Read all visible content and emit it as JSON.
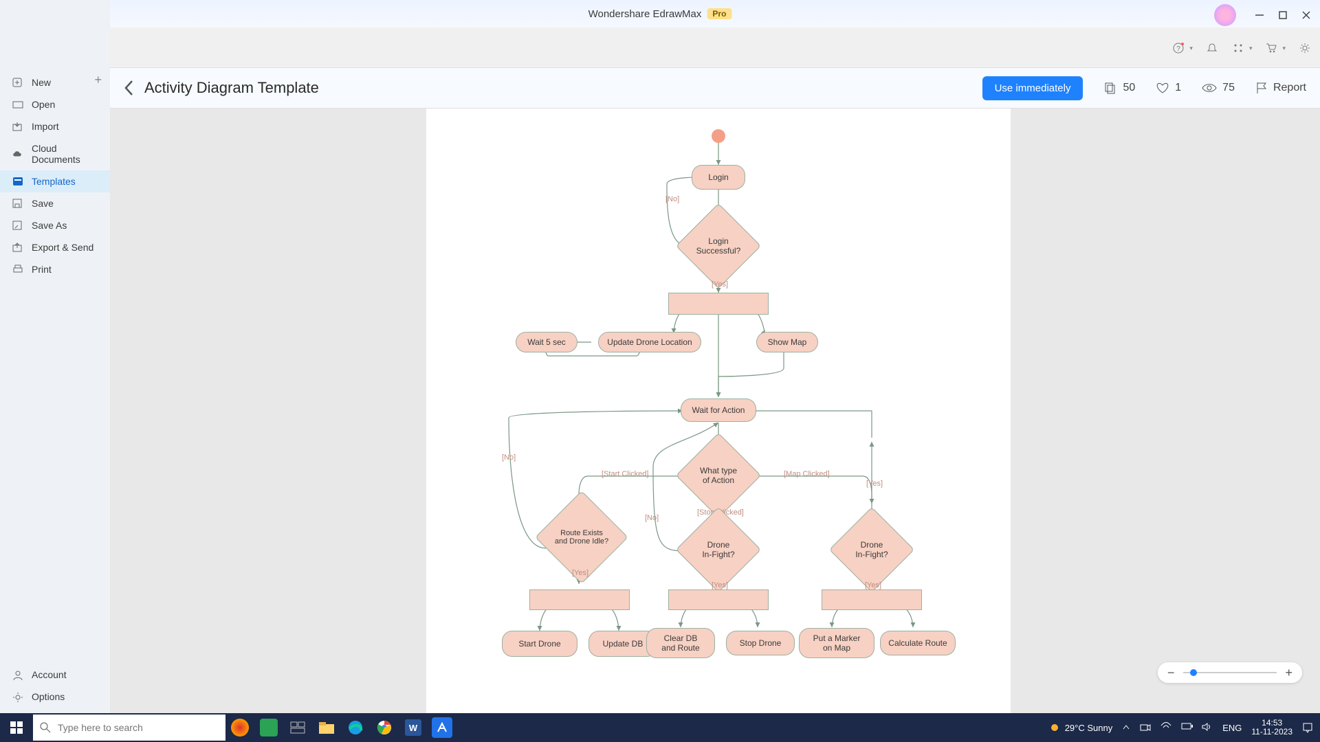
{
  "app": {
    "title": "Wondershare EdrawMax",
    "badge": "Pro"
  },
  "sidebar": {
    "items": [
      {
        "label": "New",
        "icon": "plus-box"
      },
      {
        "label": "Open",
        "icon": "folder-open"
      },
      {
        "label": "Import",
        "icon": "import"
      },
      {
        "label": "Cloud Documents",
        "icon": "cloud"
      },
      {
        "label": "Templates",
        "icon": "template"
      },
      {
        "label": "Save",
        "icon": "save"
      },
      {
        "label": "Save As",
        "icon": "save-as"
      },
      {
        "label": "Export & Send",
        "icon": "export"
      },
      {
        "label": "Print",
        "icon": "print"
      }
    ],
    "bottom": [
      {
        "label": "Account",
        "icon": "account"
      },
      {
        "label": "Options",
        "icon": "gear"
      }
    ]
  },
  "header": {
    "breadcrumb_title": "Activity Diagram Template",
    "use_button": "Use immediately",
    "copies": "50",
    "likes": "1",
    "views": "75",
    "report": "Report"
  },
  "flow": {
    "nodes": {
      "login": "Login",
      "login_successful": "Login\nSuccessful?",
      "wait5": "Wait 5 sec",
      "update_drone_loc": "Update Drone Location",
      "show_map": "Show Map",
      "wait_action": "Wait for Action",
      "what_type": "What type\nof Action",
      "route_exists": "Route Exists\nand Drone Idle?",
      "drone_infight1": "Drone\nIn-Fight?",
      "drone_infight2": "Drone\nIn-Fight?",
      "start_drone": "Start Drone",
      "update_db": "Update DB",
      "clear_db": "Clear DB\nand Route",
      "stop_drone": "Stop Drone",
      "put_marker": "Put a Marker\non Map",
      "calc_route": "Calculate Route"
    },
    "edgeLabels": {
      "no1": "[No]",
      "yes1": "[Yes]",
      "no2": "[No]",
      "yes2": "[Yes]",
      "start_clicked": "[Start Clicked]",
      "stop_clicked": "[Stop Clicked]",
      "map_clicked": "[Map Clicked]",
      "no3": "[No]",
      "yes3": "[Yes]",
      "yes4": "[Yes]",
      "yes5": "[Yes]"
    }
  },
  "taskbar": {
    "search_placeholder": "Type here to search",
    "weather": "29°C  Sunny",
    "lang": "ENG",
    "time": "14:53",
    "date": "11-11-2023"
  }
}
